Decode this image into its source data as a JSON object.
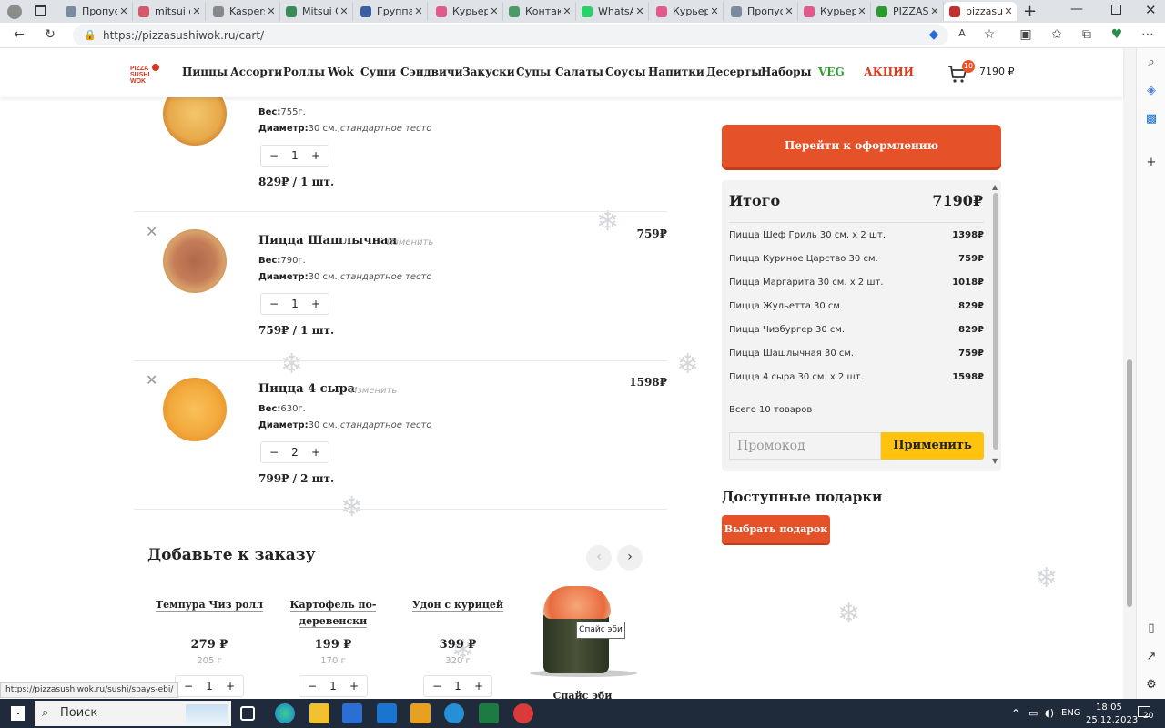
{
  "browser": {
    "tabs": [
      {
        "label": "Пропус",
        "color": "#7a8ba0"
      },
      {
        "label": "mitsui о",
        "color": "#d45a6a"
      },
      {
        "label": "Kaspers",
        "color": "#888888"
      },
      {
        "label": "Mitsui C",
        "color": "#3a8a5a"
      },
      {
        "label": "Группа",
        "color": "#3b5fa0"
      },
      {
        "label": "Курьер",
        "color": "#e05a8a"
      },
      {
        "label": "Контак",
        "color": "#4a9a6a"
      },
      {
        "label": "WhatsA",
        "color": "#25d366"
      },
      {
        "label": "Курьер",
        "color": "#e05a8a"
      },
      {
        "label": "Пропус",
        "color": "#7a8ba0"
      },
      {
        "label": "Курьер",
        "color": "#e05a8a"
      },
      {
        "label": "PIZZASI",
        "color": "#2a9a2a"
      },
      {
        "label": "pizzasu",
        "color": "#c43030"
      }
    ],
    "url": "https://pizzasushiwok.ru/cart/",
    "status_url": "https://pizzasushiwok.ru/sushi/spays-ebi/"
  },
  "header": {
    "logo_text": "PIZZA SUSHI WOK",
    "nav": [
      "Пиццы",
      "Ассорти",
      "Роллы",
      "Wok",
      "Суши",
      "Сэндвичи",
      "Закуски",
      "Супы",
      "Салаты",
      "Соусы",
      "Напитки",
      "Десерты",
      "Наборы",
      "VEG",
      "АКЦИИ"
    ],
    "cart_count": "10",
    "cart_total": "7190 ₽",
    "veg_color": "#2f9e2f",
    "sale_color": "#e03a1e"
  },
  "cart_items": [
    {
      "name": "",
      "edit": "",
      "weight_label": "Вес:",
      "weight": "755г.",
      "diameter_label": "Диаметр:",
      "diameter": "30 см.,",
      "dough": "стандартное тесто",
      "qty": "1",
      "unit_price": "829₽ / 1 шт.",
      "total": ""
    },
    {
      "name": "Пицца Шашлычная",
      "edit": "Изменить",
      "weight_label": "Вес:",
      "weight": "790г.",
      "diameter_label": "Диаметр:",
      "diameter": "30 см.,",
      "dough": "стандартное тесто",
      "qty": "1",
      "unit_price": "759₽ / 1 шт.",
      "total": "759₽"
    },
    {
      "name": "Пицца 4 сыра",
      "edit": "Изменить",
      "weight_label": "Вес:",
      "weight": "630г.",
      "diameter_label": "Диаметр:",
      "diameter": "30 см.,",
      "dough": "стандартное тесто",
      "qty": "2",
      "unit_price": "799₽ / 2 шт.",
      "total": "1598₽"
    }
  ],
  "checkout_button": "Перейти к оформлению",
  "summary": {
    "title": "Итого",
    "total": "7190₽",
    "rows": [
      {
        "name": "Пицца Шеф Гриль 30 см. х 2 шт.",
        "price": "1398₽"
      },
      {
        "name": "Пицца Куриное Царство 30 см.",
        "price": "759₽"
      },
      {
        "name": "Пицца Маргарита 30 см. х 2 шт.",
        "price": "1018₽"
      },
      {
        "name": "Пицца Жульетта 30 см.",
        "price": "829₽"
      },
      {
        "name": "Пицца Чизбургер 30 см.",
        "price": "829₽"
      },
      {
        "name": "Пицца Шашлычная 30 см.",
        "price": "759₽"
      },
      {
        "name": "Пицца 4 сыра 30 см. х 2 шт.",
        "price": "1598₽"
      }
    ],
    "count": "Всего 10 товаров",
    "promo_placeholder": "Промокод",
    "apply": "Применить"
  },
  "gifts": {
    "title": "Доступные подарки",
    "button": "Выбрать подарок"
  },
  "upsell": {
    "title": "Добавьте к заказу",
    "items": [
      {
        "name": "Темпура Чиз ролл",
        "price": "279 ₽",
        "weight": "205 г",
        "qty": "1"
      },
      {
        "name": "Картофель по-деревенски",
        "price": "199 ₽",
        "weight": "170 г",
        "qty": "1"
      },
      {
        "name": "Удон с курицей",
        "price": "399 ₽",
        "weight": "320 г",
        "qty": "1"
      },
      {
        "name": "Спайс эби",
        "price": "",
        "weight": "",
        "qty": ""
      }
    ],
    "tooltip": "Спайс эби"
  },
  "taskbar": {
    "search": "Поиск",
    "lang": "ENG",
    "time": "18:05",
    "date": "25.12.2023",
    "notif": "20"
  }
}
